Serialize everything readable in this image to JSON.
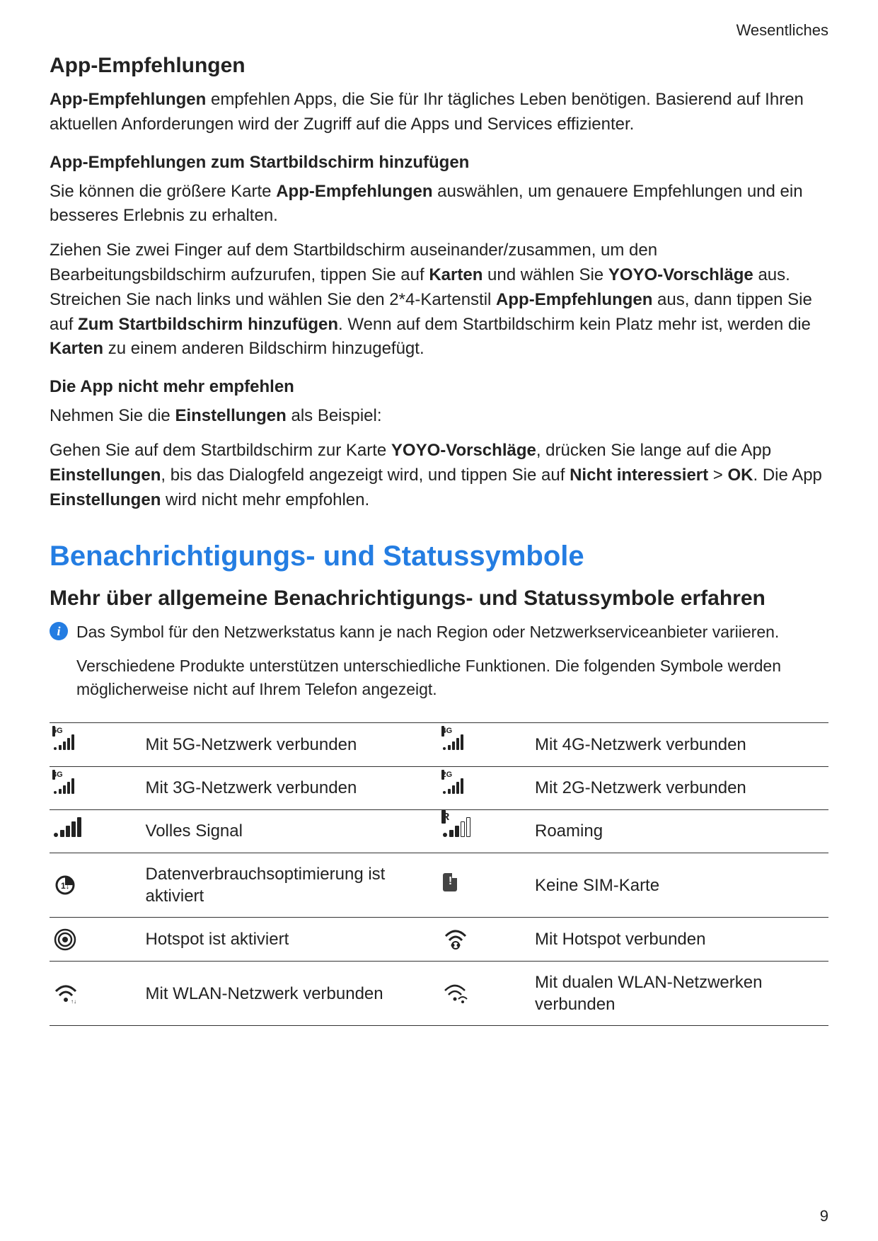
{
  "header": {
    "breadcrumb": "Wesentliches"
  },
  "s1": {
    "title": "App-Empfehlungen",
    "p1_bold": "App-Empfehlungen",
    "p1_rest": " empfehlen Apps, die Sie für Ihr tägliches Leben benötigen. Basierend auf Ihren aktuellen Anforderungen wird der Zugriff auf die Apps und Services effizienter."
  },
  "s2": {
    "title": "App-Empfehlungen zum Startbildschirm hinzufügen",
    "p1_a": "Sie können die größere Karte ",
    "p1_b": "App-Empfehlungen",
    "p1_c": " auswählen, um genauere Empfehlungen und ein besseres Erlebnis zu erhalten.",
    "p2_a": "Ziehen Sie zwei Finger auf dem Startbildschirm auseinander/zusammen, um den Bearbeitungsbildschirm aufzurufen, tippen Sie auf ",
    "p2_b": "Karten",
    "p2_c": " und wählen Sie ",
    "p2_d": "YOYO-Vorschläge",
    "p2_e": " aus. Streichen Sie nach links und wählen Sie den 2*4-Kartenstil ",
    "p2_f": "App-Empfehlungen",
    "p2_g": " aus, dann tippen Sie auf ",
    "p2_h": "Zum Startbildschirm hinzufügen",
    "p2_i": ". Wenn auf dem Startbildschirm kein Platz mehr ist, werden die ",
    "p2_j": "Karten",
    "p2_k": " zu einem anderen Bildschirm hinzugefügt."
  },
  "s3": {
    "title": "Die App nicht mehr empfehlen",
    "p1_a": "Nehmen Sie die ",
    "p1_b": "Einstellungen",
    "p1_c": " als Beispiel:",
    "p2_a": "Gehen Sie auf dem Startbildschirm zur Karte ",
    "p2_b": "YOYO-Vorschläge",
    "p2_c": ", drücken Sie lange auf die App ",
    "p2_d": "Einstellungen",
    "p2_e": ", bis das Dialogfeld angezeigt wird, und tippen Sie auf ",
    "p2_f": "Nicht interessiert",
    "p2_g": " > ",
    "p2_h": "OK",
    "p2_i": ". Die App ",
    "p2_j": "Einstellungen",
    "p2_k": " wird nicht mehr empfohlen."
  },
  "chapter": {
    "title": "Benachrichtigungs- und Statussymbole"
  },
  "s4": {
    "title": "Mehr über allgemeine Benachrichtigungs- und Statussymbole erfahren",
    "note1": "Das Symbol für den Netzwerkstatus kann je nach Region oder Netzwerkserviceanbieter variieren.",
    "note2": "Verschiedene Produkte unterstützen unterschiedliche Funktionen. Die folgenden Symbole werden möglicherweise nicht auf Ihrem Telefon angezeigt."
  },
  "table": {
    "rows": [
      {
        "iconL": "5G",
        "descL": "Mit 5G-Netzwerk verbunden",
        "iconR": "4G",
        "descR": "Mit 4G-Netzwerk verbunden"
      },
      {
        "iconL": "3G",
        "descL": "Mit 3G-Netzwerk verbunden",
        "iconR": "2G",
        "descR": "Mit 2G-Netzwerk verbunden"
      },
      {
        "iconL": "full",
        "descL": "Volles Signal",
        "iconR": "R",
        "descR": "Roaming"
      },
      {
        "iconL": "dataopt",
        "descL": "Datenverbrauchsoptimierung ist aktiviert",
        "iconR": "nosim",
        "descR": "Keine SIM-Karte"
      },
      {
        "iconL": "hotspot",
        "descL": "Hotspot ist aktiviert",
        "iconR": "hotspot-conn",
        "descR": "Mit Hotspot verbunden"
      },
      {
        "iconL": "wifi",
        "descL": "Mit WLAN-Netzwerk verbunden",
        "iconR": "wifi-dual",
        "descR": "Mit dualen WLAN-Netzwerken verbunden"
      }
    ]
  },
  "pageNumber": "9"
}
